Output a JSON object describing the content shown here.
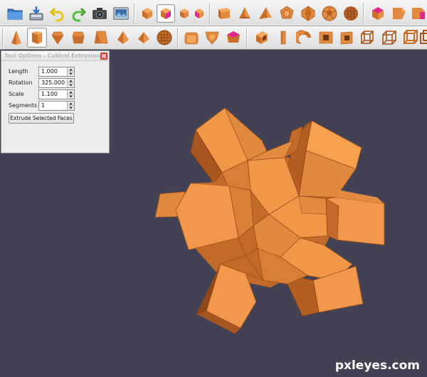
{
  "toolbar_top": {
    "buttons": [
      {
        "icon": "open-folder-icon"
      },
      {
        "icon": "save-icon"
      },
      {
        "icon": "undo-icon"
      },
      {
        "icon": "redo-icon"
      },
      {
        "icon": "camera-icon"
      },
      {
        "icon": "render-image-icon"
      },
      {
        "icon": "cube-icon"
      },
      {
        "icon": "cube-selected-face-icon"
      },
      {
        "icon": "cube-face-icon"
      },
      {
        "icon": "cube-face-variant-icon"
      },
      {
        "icon": "cube-shape-icon"
      },
      {
        "icon": "tetrahedron-icon"
      },
      {
        "icon": "pyramid-icon"
      },
      {
        "icon": "dodecahedron-icon"
      },
      {
        "icon": "icosahedron-icon"
      },
      {
        "icon": "truncated-icosahedron-icon"
      },
      {
        "icon": "geodesic-sphere-icon"
      },
      {
        "icon": "cube-selected-top-icon"
      },
      {
        "icon": "cube-tool-icon"
      },
      {
        "icon": "cube-tool-variant-icon"
      }
    ]
  },
  "toolbar_second": {
    "buttons": [
      {
        "icon": "extrude-pyramid-icon"
      },
      {
        "icon": "cubical-extrusion-icon",
        "active": true
      },
      {
        "icon": "prism-extrusion-icon"
      },
      {
        "icon": "beveled-extrusion-icon"
      },
      {
        "icon": "tapered-extrusion-icon"
      },
      {
        "icon": "spike-extrusion-icon"
      },
      {
        "icon": "stellate-icon"
      },
      {
        "icon": "subdivide-sphere-icon"
      },
      {
        "icon": "cube-bevel-icon"
      },
      {
        "icon": "shield-face-icon"
      },
      {
        "icon": "pentagon-selected-icon"
      },
      {
        "icon": "box-hollow-icon"
      },
      {
        "icon": "slab-icon"
      },
      {
        "icon": "torus-segment-icon"
      },
      {
        "icon": "ring-box-icon"
      },
      {
        "icon": "ring-box-variant-icon"
      },
      {
        "icon": "wireframe-cube-icon"
      },
      {
        "icon": "wireframe-cube-variant-icon"
      },
      {
        "icon": "wireframe-frame-icon"
      },
      {
        "icon": "wireframe-double-frame-icon"
      }
    ]
  },
  "tool_options": {
    "title": "Tool Options - Cubical Extrusion",
    "fields": [
      {
        "label": "Length",
        "value": "1.000"
      },
      {
        "label": "Rotation",
        "value": "325.000"
      },
      {
        "label": "Scale",
        "value": "1.100"
      },
      {
        "label": "Segments",
        "value": "1"
      }
    ],
    "action_label": "Extrude Selected Faces"
  },
  "viewport": {
    "model_color": "#e8883c",
    "background_color": "#424254"
  },
  "watermark": "pxleyes.com"
}
